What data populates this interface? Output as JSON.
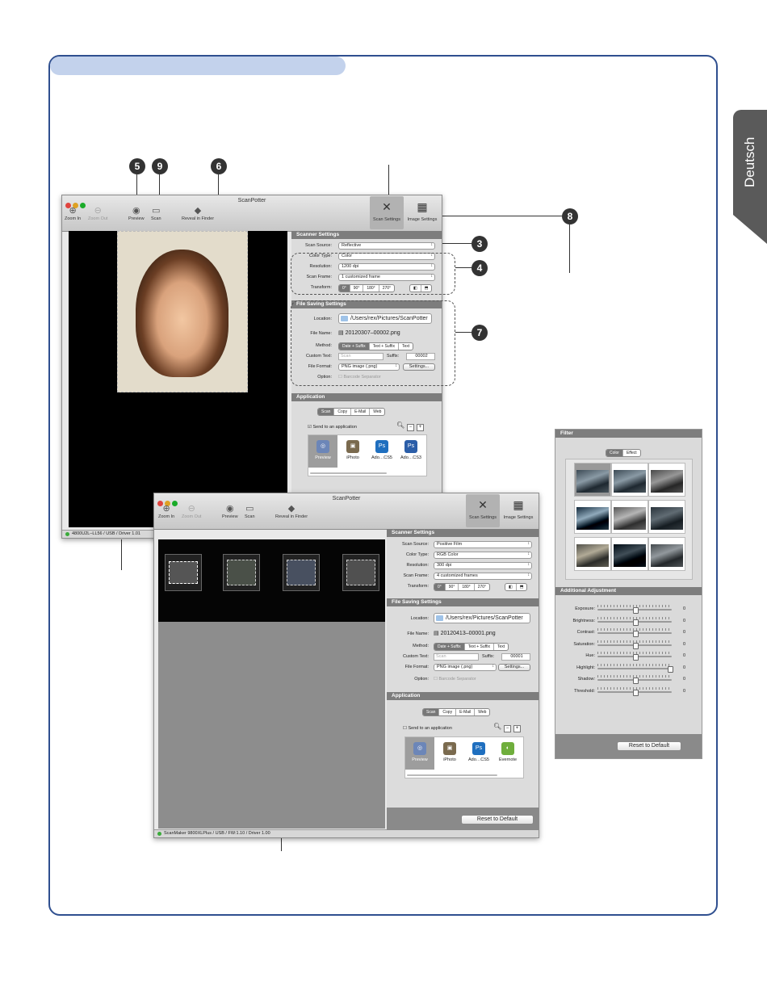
{
  "side_tab": "Deutsch",
  "callouts": [
    "5",
    "9",
    "6",
    "3",
    "4",
    "7",
    "8"
  ],
  "win1": {
    "title": "ScanPotter",
    "toolbar": {
      "zoom_in": "Zoom In",
      "zoom_out": "Zoom Out",
      "preview": "Preview",
      "scan": "Scan",
      "reveal": "Reveal in Finder",
      "scan_settings": "Scan Settings",
      "image_settings": "Image Settings"
    },
    "scanner_settings": {
      "header": "Scanner Settings",
      "scan_source_label": "Scan Source:",
      "scan_source": "Reflective",
      "color_type_label": "Color Type:",
      "color_type": "Color",
      "resolution_label": "Resolution:",
      "resolution": "1200 dpi",
      "scan_frame_label": "Scan Frame:",
      "scan_frame": "1 customized frame",
      "transform_label": "Transform:",
      "transform": [
        "0°",
        "90°",
        "180°",
        "270°"
      ]
    },
    "file_saving": {
      "header": "File Saving Settings",
      "location_label": "Location:",
      "location": "/Users/rex/Pictures/ScanPotter",
      "file_name_label": "File Name:",
      "file_name": "20120307–00002.png",
      "method_label": "Method:",
      "methods": [
        "Date + Suffix",
        "Text + Suffix",
        "Text"
      ],
      "custom_text_label": "Custom Text:",
      "custom_text_placeholder": "Scan",
      "suffix_label": "Suffix:",
      "suffix": "00002",
      "file_format_label": "File Format:",
      "file_format": "PNG image (.png)",
      "settings_btn": "Settings...",
      "option_label": "Option:",
      "barcode": "Barcode Separator"
    },
    "application": {
      "header": "Application",
      "tabs": [
        "Scan",
        "Copy",
        "E-Mail",
        "Web"
      ],
      "send_label": "Send to an application",
      "apps": [
        "Preview",
        "iPhoto",
        "Ado…CS5",
        "Ado…CS3"
      ]
    },
    "status": "4800U2L–LL56 / USB / Driver 1.01"
  },
  "win2": {
    "title": "ScanPotter",
    "toolbar": {
      "zoom_in": "Zoom In",
      "zoom_out": "Zoom Out",
      "preview": "Preview",
      "scan": "Scan",
      "reveal": "Reveal in Finder",
      "scan_settings": "Scan Settings",
      "image_settings": "Image Settings"
    },
    "scanner_settings": {
      "header": "Scanner Settings",
      "scan_source_label": "Scan Source:",
      "scan_source": "Positive Film",
      "color_type_label": "Color Type:",
      "color_type": "RGB Color",
      "resolution_label": "Resolution:",
      "resolution": "300 dpi",
      "scan_frame_label": "Scan Frame:",
      "scan_frame": "4 customized frames",
      "transform_label": "Transform:",
      "transform": [
        "0°",
        "90°",
        "180°",
        "270°"
      ]
    },
    "file_saving": {
      "header": "File Saving Settings",
      "location_label": "Location:",
      "location": "/Users/rex/Pictures/ScanPotter",
      "file_name_label": "File Name:",
      "file_name": "20120413–00001.png",
      "method_label": "Method:",
      "methods": [
        "Date + Suffix",
        "Text + Suffix",
        "Text"
      ],
      "custom_text_label": "Custom Text:",
      "custom_text_placeholder": "Scan",
      "suffix_label": "Suffix:",
      "suffix": "00001",
      "file_format_label": "File Format:",
      "file_format": "PNG image (.png)",
      "settings_btn": "Settings...",
      "option_label": "Option:",
      "barcode": "Barcode Separator"
    },
    "application": {
      "header": "Application",
      "tabs": [
        "Scan",
        "Copy",
        "E-Mail",
        "Web"
      ],
      "send_label": "Send to an application",
      "apps": [
        "Preview",
        "iPhoto",
        "Ado…CS5",
        "Evernote"
      ]
    },
    "reset": "Reset to Default",
    "status": "ScanMaker 9800XLPlus / USB / FW:1.10 / Driver 1.00"
  },
  "filter_panel": {
    "header": "Filter",
    "tabs": [
      "Color",
      "Effect"
    ],
    "additional_header": "Additional Adjustment",
    "adjustments": [
      {
        "label": "Exposure:",
        "value": "0",
        "level": 0.5
      },
      {
        "label": "Brightness:",
        "value": "0",
        "level": 0.5
      },
      {
        "label": "Contrast:",
        "value": "0",
        "level": 0.5
      },
      {
        "label": "Saturation:",
        "value": "0",
        "level": 0.5
      },
      {
        "label": "Hue:",
        "value": "0",
        "level": 0.5
      },
      {
        "label": "Highlight:",
        "value": "0",
        "level": 1.0
      },
      {
        "label": "Shadow:",
        "value": "0",
        "level": 0.5
      },
      {
        "label": "Threshold:",
        "value": "0",
        "level": 0.5
      }
    ],
    "reset": "Reset to Default"
  }
}
